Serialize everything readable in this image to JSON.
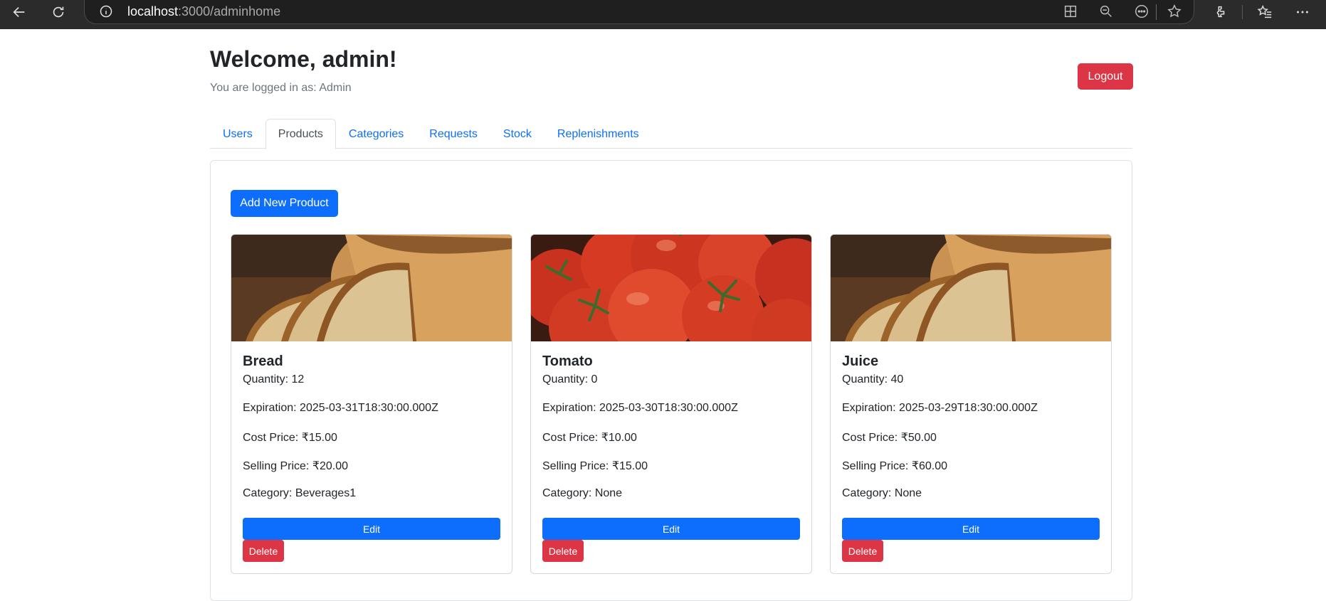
{
  "browser": {
    "url_host": "localhost",
    "url_rest": ":3000/adminhome"
  },
  "header": {
    "welcome": "Welcome, admin!",
    "logged_in": "You are logged in as: Admin",
    "logout_label": "Logout"
  },
  "tabs": [
    {
      "label": "Users",
      "active": false
    },
    {
      "label": "Products",
      "active": true
    },
    {
      "label": "Categories",
      "active": false
    },
    {
      "label": "Requests",
      "active": false
    },
    {
      "label": "Stock",
      "active": false
    },
    {
      "label": "Replenishments",
      "active": false
    }
  ],
  "products_panel": {
    "add_label": "Add New Product",
    "edit_label": "Edit",
    "delete_label": "Delete",
    "cards": [
      {
        "name": "Bread",
        "image": "bread-photo",
        "quantity": "Quantity: 12",
        "expiration": "Expiration: 2025-03-31T18:30:00.000Z",
        "cost_price": "Cost Price: ₹15.00",
        "selling_price": "Selling Price: ₹20.00",
        "category": "Category: Beverages1"
      },
      {
        "name": "Tomato",
        "image": "tomato-photo",
        "quantity": "Quantity: 0",
        "expiration": "Expiration: 2025-03-30T18:30:00.000Z",
        "cost_price": "Cost Price: ₹10.00",
        "selling_price": "Selling Price: ₹15.00",
        "category": "Category: None"
      },
      {
        "name": "Juice",
        "image": "bread-photo",
        "quantity": "Quantity: 40",
        "expiration": "Expiration: 2025-03-29T18:30:00.000Z",
        "cost_price": "Cost Price: ₹50.00",
        "selling_price": "Selling Price: ₹60.00",
        "category": "Category: None"
      }
    ]
  },
  "colors": {
    "primary": "#0d6efd",
    "danger": "#dc3545",
    "muted": "#6c757d",
    "chrome": "#2b2b2b"
  }
}
